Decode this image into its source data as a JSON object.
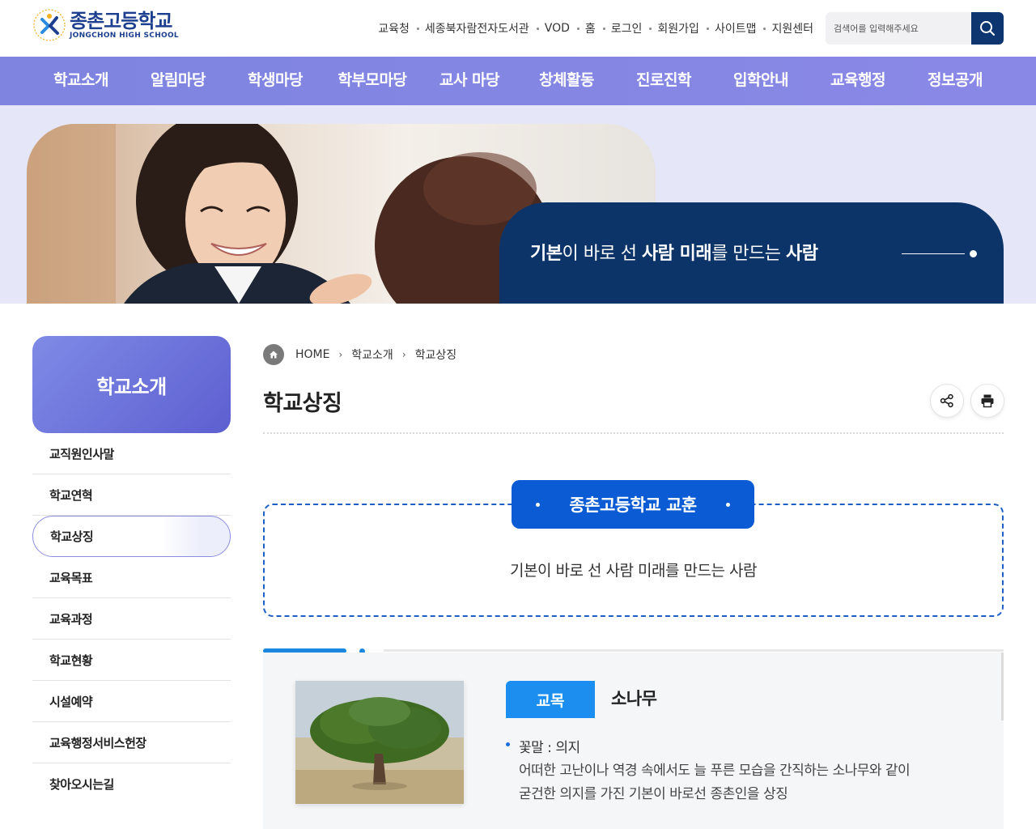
{
  "header": {
    "logo": {
      "name": "종촌고등학교",
      "sub": "JONGCHON HIGH SCHOOL"
    },
    "util_links": [
      "교육청",
      "세종북자람전자도서관",
      "VOD",
      "홈",
      "로그인",
      "회원가입",
      "사이트맵",
      "지원센터"
    ],
    "search": {
      "placeholder": "검색어를 입력해주세요"
    }
  },
  "gnb": [
    "학교소개",
    "알림마당",
    "학생마당",
    "학부모마당",
    "교사 마당",
    "창체활동",
    "진로진학",
    "입학안내",
    "교육행정",
    "정보공개"
  ],
  "hero": {
    "slogan_parts": [
      {
        "text": "기본",
        "bold": true
      },
      {
        "text": "이 바로 선 ",
        "bold": false
      },
      {
        "text": "사람 미래",
        "bold": true
      },
      {
        "text": "를 만드는 ",
        "bold": false
      },
      {
        "text": "사람",
        "bold": true
      }
    ]
  },
  "sidebar": {
    "title": "학교소개",
    "items": [
      "교직원인사말",
      "학교연혁",
      "학교상징",
      "교육목표",
      "교육과정",
      "학교현황",
      "시설예약",
      "교육행정서비스헌장",
      "찾아오시는길"
    ],
    "active_index": 2
  },
  "breadcrumb": [
    "HOME",
    "학교소개",
    "학교상징"
  ],
  "page_title": "학교상징",
  "motto": {
    "tag": "종촌고등학교 교훈",
    "text": "기본이 바로 선 사람 미래를 만드는 사람"
  },
  "symbol": {
    "label": "교목",
    "value": "소나무",
    "flower_word": "꽃말 : 의지",
    "description": [
      "어떠한 고난이나 역경 속에서도 늘 푸른 모습을 간직하는 소나무와 같이",
      "굳건한 의지를 가진 기본이 바로선 종촌인을 상징"
    ]
  },
  "colors": {
    "nav": "#8387e3",
    "navy": "#0c3469",
    "accent": "#0a5bd4",
    "sky": "#1b8ef0"
  }
}
